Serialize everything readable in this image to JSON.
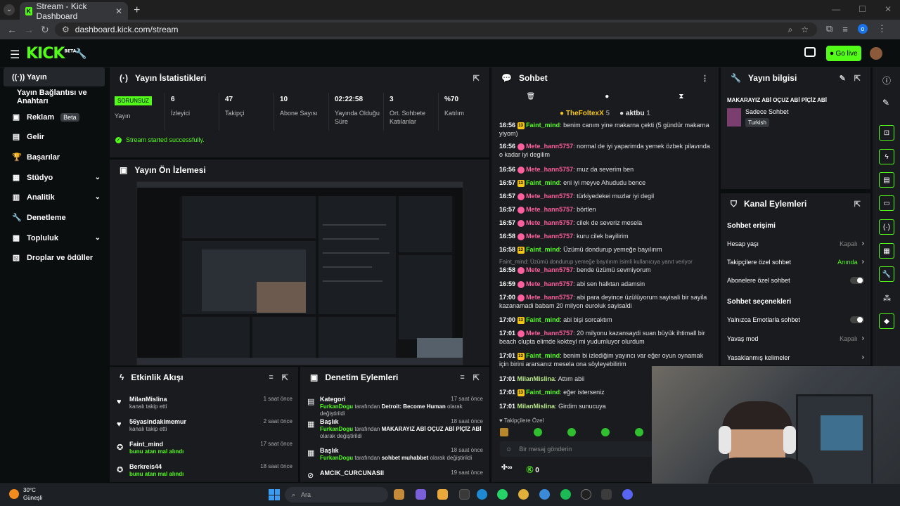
{
  "browser": {
    "tab_title": "Stream - Kick Dashboard",
    "url": "dashboard.kick.com/stream",
    "profile_initial": "o"
  },
  "topnav": {
    "logo": "KICK",
    "logo_badge": "BETA",
    "go_live": "Go live"
  },
  "sidebar": {
    "items": [
      {
        "label": "Yayın"
      },
      {
        "label": "Yayın Bağlantısı ve Anahtarı"
      },
      {
        "label": "Reklam",
        "badge": "Beta"
      },
      {
        "label": "Gelir"
      },
      {
        "label": "Başarılar"
      },
      {
        "label": "Stüdyo"
      },
      {
        "label": "Analitik"
      },
      {
        "label": "Denetleme"
      },
      {
        "label": "Topluluk"
      },
      {
        "label": "Droplar ve ödüller"
      }
    ]
  },
  "stats": {
    "title": "Yayın İstatistikleri",
    "status": "SORUNSUZ",
    "status_label": "Yayın",
    "items": [
      {
        "value": "6",
        "label": "İzleyici"
      },
      {
        "value": "47",
        "label": "Takipçi"
      },
      {
        "value": "10",
        "label": "Abone Sayısı"
      },
      {
        "value": "02:22:58",
        "label": "Yayında Olduğu Süre"
      },
      {
        "value": "3",
        "label": "Ort. Sohbete Katılanlar"
      },
      {
        "value": "%70",
        "label": "Katılım"
      }
    ],
    "success": "Stream started successfully."
  },
  "preview": {
    "title": "Yayın Ön İzlemesi"
  },
  "activity": {
    "title": "Etkinlik Akışı",
    "rows": [
      {
        "name": "MilanMislina",
        "desc": "kanalı takip etti",
        "time": "1 saat önce"
      },
      {
        "name": "56yasindakimemur",
        "desc": "kanalı takip etti",
        "time": "2 saat önce"
      },
      {
        "name": "Faint_mind",
        "desc": "bunu atan mal alındı",
        "time": "17 saat önce"
      },
      {
        "name": "Berkreis44",
        "desc": "bunu atan mal alındı",
        "time": "18 saat önce"
      }
    ]
  },
  "moderation": {
    "title": "Denetim Eylemleri",
    "rows": [
      {
        "name": "Kategori",
        "user": "FurkanDogu",
        "mid": "tarafından",
        "value": "Detroit: Become Human",
        "tail": "olarak değiştirildi",
        "time": "17 saat önce"
      },
      {
        "name": "Başlık",
        "user": "FurkanDogu",
        "mid": "tarafından",
        "value": "MAKARAYIZ ABİ OÇUZ ABİ PİÇİZ ABİ",
        "tail": "olarak değiştirildi",
        "time": "18 saat önce"
      },
      {
        "name": "Başlık",
        "user": "FurkanDogu",
        "mid": "tarafından",
        "value": "sohbet muhabbet",
        "tail": "olarak değiştirildi",
        "time": "18 saat önce"
      },
      {
        "name": "AMCIK_CURCUNASII",
        "user": "",
        "mid": "",
        "value": "",
        "tail": "",
        "time": "19 saat önce"
      }
    ]
  },
  "chat": {
    "title": "Sohbet",
    "pinned": [
      {
        "name": "TheFoltexX",
        "count": "5"
      },
      {
        "name": "aktbu",
        "count": "1"
      }
    ],
    "messages": [
      {
        "time": "16:56",
        "badge": "13",
        "user": "Faint_mind",
        "text": "benim canım yine makarna çekti (5 gündür makarna yiyom)"
      },
      {
        "time": "16:56",
        "badge": "",
        "user": "Mete_hann5757",
        "text": "normal de iyi yaparimda yemek özbek pilavında o kadar iyi degilim"
      },
      {
        "time": "16:56",
        "badge": "",
        "user": "Mete_hann5757",
        "text": "muz da severim ben"
      },
      {
        "time": "16:57",
        "badge": "13",
        "user": "Faint_mind",
        "text": "eni iyi meyve Ahududu bence"
      },
      {
        "time": "16:57",
        "badge": "",
        "user": "Mete_hann5757",
        "text": "türkiyedekei muzlar iyi degil"
      },
      {
        "time": "16:57",
        "badge": "",
        "user": "Mete_hann5757",
        "text": "börtlen"
      },
      {
        "time": "16:57",
        "badge": "",
        "user": "Mete_hann5757",
        "text": "cilek de severiz mesela"
      },
      {
        "time": "16:58",
        "badge": "",
        "user": "Mete_hann5757",
        "text": "kuru cilek bayilirim"
      },
      {
        "time": "16:58",
        "badge": "13",
        "user": "Faint_mind",
        "text": "Üzümü dondurup yemeğe bayılırım"
      },
      {
        "time": "16:58",
        "badge": "",
        "user": "Mete_hann5757",
        "text": "bende üzümü sevmiyorum"
      },
      {
        "time": "16:59",
        "badge": "",
        "user": "Mete_hann5757",
        "text": "abi sen halktan adamsin"
      },
      {
        "time": "17:00",
        "badge": "",
        "user": "Mete_hann5757",
        "text": "abi para deyince üzülüyorum sayisali bir sayila kazanamadi babam 20 milyon euroluk sayisaldi"
      },
      {
        "time": "17:00",
        "badge": "13",
        "user": "Faint_mind",
        "text": "abi bişi sorcaktım"
      },
      {
        "time": "17:01",
        "badge": "",
        "user": "Mete_hann5757",
        "text": "20 milyonu kazansaydi suan büyük ihtimall bir beach clupta elimde kokteyl mi yudumluyor olurdum"
      },
      {
        "time": "17:01",
        "badge": "13",
        "user": "Faint_mind",
        "text": "benim bi izlediğim yayıncı var eğer oyun oynamak için birini ararsanız mesela ona söyleyebilirim"
      },
      {
        "time": "17:01",
        "badge": "",
        "user": "MilanMislina",
        "text": "Attım abii"
      },
      {
        "time": "17:01",
        "badge": "13",
        "user": "Faint_mind",
        "text": "eğer isterseniz"
      },
      {
        "time": "17:01",
        "badge": "",
        "user": "MilanMislina",
        "text": "Girdim sunucuya"
      }
    ],
    "reply_note": "Faint_mind: Üzümü dondurup yemeğe bayılırım isimli kullanıcıya yanıt veriyor",
    "followers_only": "Takipçilere Özel",
    "input_placeholder": "Bir mesaj gönderin",
    "footer_count": "0"
  },
  "info": {
    "title": "Yayın bilgisi",
    "stream_title": "MAKARAYIZ ABİ OÇUZ ABİ PİÇİZ ABİ",
    "category": "Sadece Sohbet",
    "language": "Turkish"
  },
  "kanal": {
    "title": "Kanal Eylemleri",
    "section1": "Sohbet erişimi",
    "rows1": [
      {
        "label": "Hesap yaşı",
        "value": "Kapalı",
        "type": "arrow"
      },
      {
        "label": "Takipçilere özel sohbet",
        "value": "Anında",
        "type": "arrow"
      },
      {
        "label": "Abonelere özel sohbet",
        "value": "",
        "type": "toggle"
      }
    ],
    "section2": "Sohbet seçenekleri",
    "rows2": [
      {
        "label": "Yalnızca Emotlarla sohbet",
        "value": "",
        "type": "toggle"
      },
      {
        "label": "Yavaş mod",
        "value": "Kapalı",
        "type": "arrow"
      },
      {
        "label": "Yasaklanmış kelimeler",
        "value": "",
        "type": "arrow"
      }
    ]
  },
  "taskbar": {
    "temperature": "30°C",
    "weather": "Güneşli",
    "search_placeholder": "Ara"
  },
  "colors": {
    "accent": "#53fc18",
    "danger": "#ff5f9e",
    "panel": "#191b1f"
  }
}
